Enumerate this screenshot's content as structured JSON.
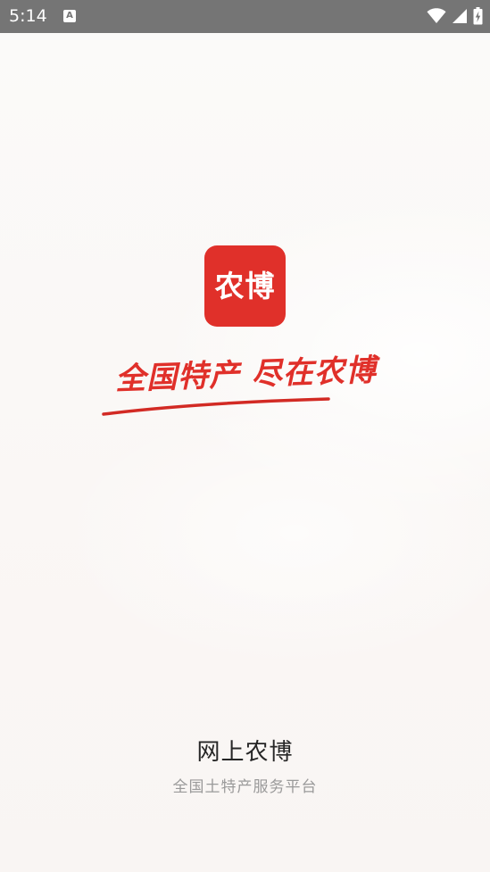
{
  "status_bar": {
    "time": "5:14",
    "notification_icon": "A",
    "icons": [
      "wifi-icon",
      "cell-signal-icon",
      "battery-charging-icon"
    ]
  },
  "splash": {
    "logo_text": "农博",
    "slogan": "全国特产 尽在农博",
    "footer_title": "网上农博",
    "footer_subtitle": "全国土特产服务平台"
  },
  "colors": {
    "brand_red": "#e0302a",
    "status_bar": "#757575",
    "background": "#fbf9f8",
    "footer_title": "#262626",
    "footer_subtitle": "#9a9a9a"
  }
}
